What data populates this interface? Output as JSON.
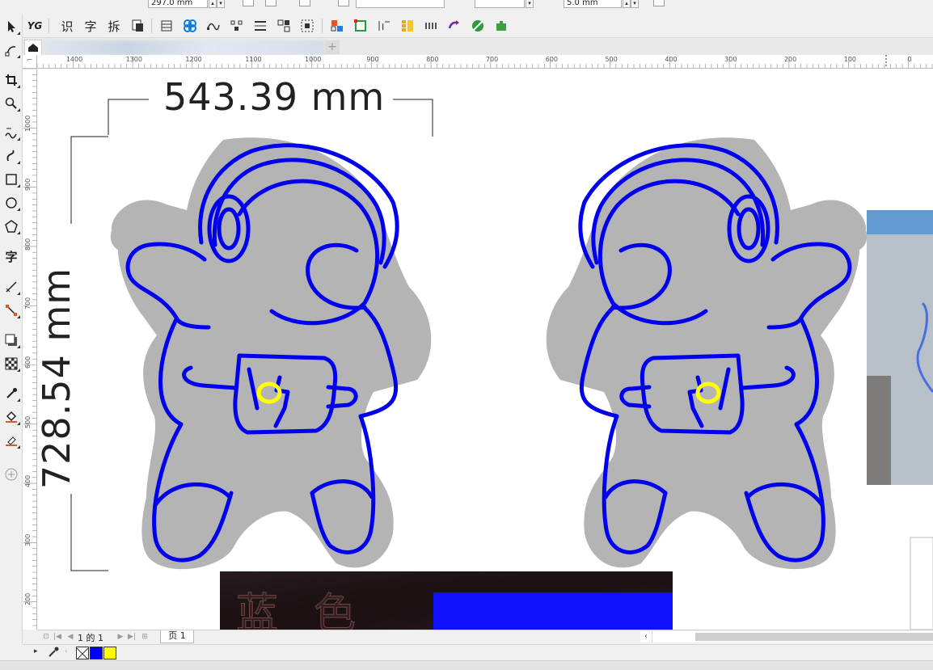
{
  "propbar": {
    "height_value": "297.0 mm",
    "outline_width": "5.0 mm"
  },
  "toolbar": {
    "text_tool_glyph_1": "识",
    "text_tool_glyph_2": "字",
    "text_tool_glyph_3": "拆",
    "yg_label": "YG"
  },
  "toolbox": {
    "text_tool": "字"
  },
  "ruler": {
    "horizontal_ticks": [
      "1400",
      "1300",
      "1200",
      "1100",
      "1000",
      "900",
      "800",
      "700",
      "600",
      "500",
      "400",
      "300",
      "200",
      "100",
      "0"
    ],
    "vertical_ticks": [
      "1000",
      "900",
      "800",
      "700",
      "600",
      "500",
      "400",
      "300",
      "200"
    ]
  },
  "canvas": {
    "dimension_width": "543.39 mm",
    "dimension_height": "728.54 mm",
    "photo_text": "蓝色",
    "colors": {
      "outline": "#0000ee",
      "fill": "#b4b4b4",
      "accent": "#ffff00"
    }
  },
  "pagenav": {
    "page_counter": "1 的 1",
    "page_tab": "页 1"
  },
  "palette": {
    "swatches": [
      "#0000ff",
      "#ffff00"
    ]
  }
}
